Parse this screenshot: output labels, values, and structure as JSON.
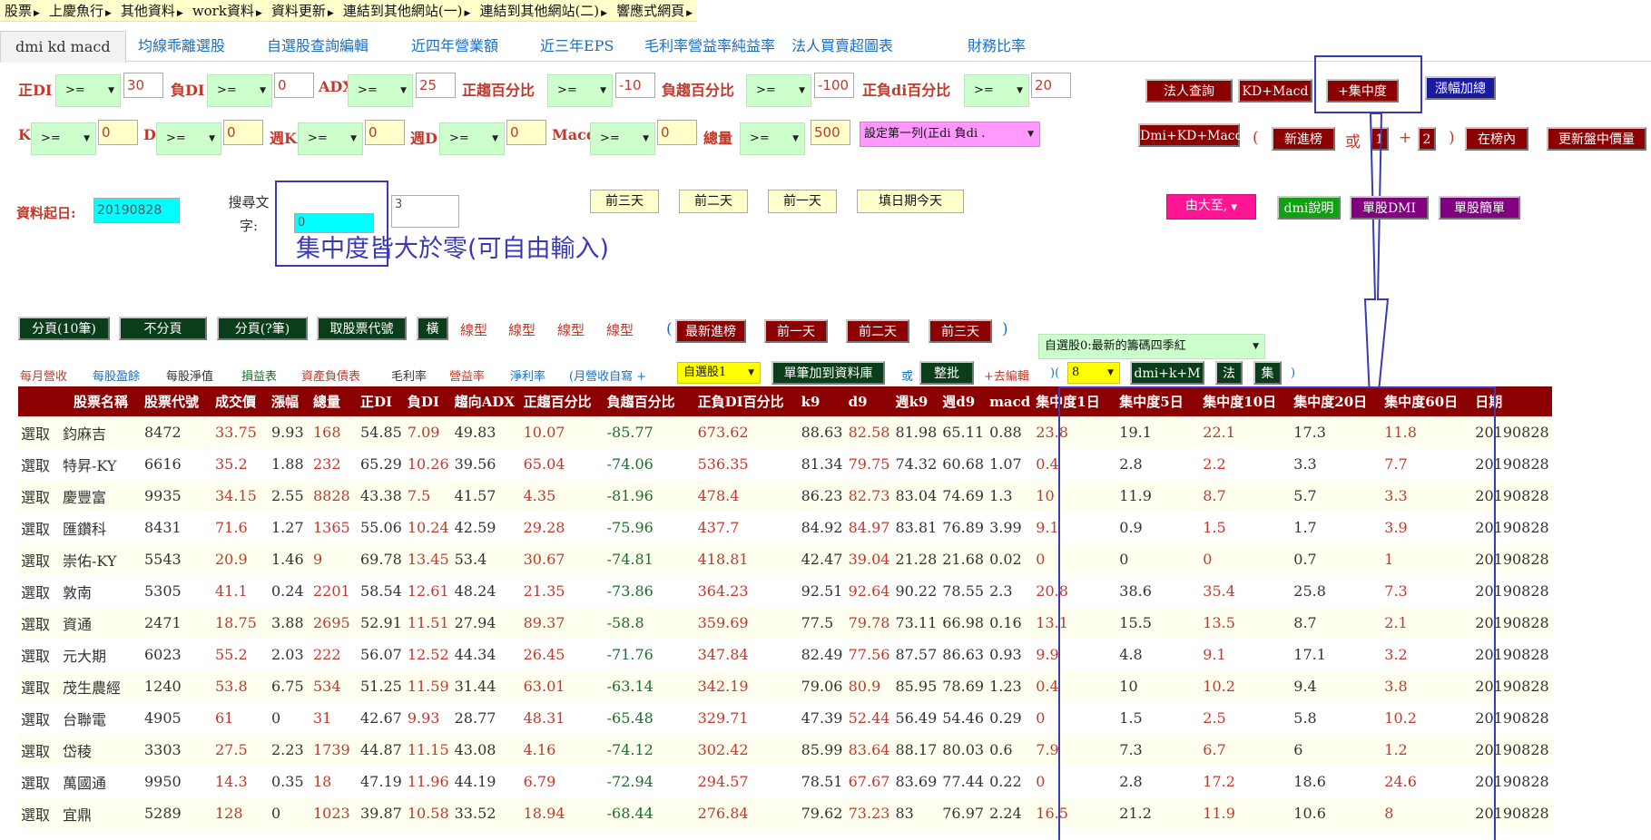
{
  "topnav": [
    "股票",
    "上慶魚行",
    "其他資料",
    "work資料",
    "資料更新",
    "連結到其他網站(一)",
    "連結到其他網站(二)",
    "響應式網頁"
  ],
  "tabs": [
    "dmi kd macd",
    "均線乖離選股",
    "自選股查詢編輯",
    "近四年營業額",
    "近三年EPS",
    "毛利率營益率純益率",
    "法人買賣超圖表",
    "財務比率"
  ],
  "row1": {
    "labels": [
      "正DI",
      "負DI",
      "ADX",
      "正趨百分比",
      "負趨百分比",
      "正負di百分比"
    ],
    "ops": [
      ">=",
      ">=",
      ">=",
      ">=",
      ">=",
      ">="
    ],
    "values": [
      "30",
      "0",
      "25",
      "-10",
      "-100",
      "20"
    ]
  },
  "row2": {
    "labels": [
      "K",
      "D",
      "週K",
      "週D",
      "Macd",
      "總量"
    ],
    "ops": [
      ">=",
      ">=",
      ">=",
      ">=",
      ">=",
      ">="
    ],
    "values": [
      "0",
      "0",
      "0",
      "0",
      "0",
      "500"
    ],
    "sort_select": "設定第一列(正di 負di ."
  },
  "buttons": {
    "inst": "法人查詢",
    "kdmacd": "KD+Macd",
    "conc": "+集中度",
    "rise": "漲幅加總",
    "dmikdmacd": "Dmi+KD+Macd",
    "paren_open": "(",
    "newlist": "新進榜",
    "or": "或",
    "n1": "1",
    "plus": "+",
    "n2": "2",
    "paren_close": ")",
    "inlist": "在榜內",
    "update": "更新盤中價量"
  },
  "date": {
    "label": "資料起日:",
    "value": "20190828"
  },
  "search": {
    "label": "搜尋文字:",
    "value": "0",
    "textarea": "3"
  },
  "daybtns": [
    "前三天",
    "前二天",
    "前一天",
    "填日期今天"
  ],
  "rightbtns": {
    "sort": "由大至,",
    "dmi_help": "dmi說明",
    "single_dmi": "單股DMI",
    "single_simple": "單股簡單"
  },
  "annotation": "集中度皆大於零(可自由輸入)",
  "row4": {
    "btns": [
      "分頁(10筆)",
      "不分頁",
      "分頁(?筆)",
      "取股票代號",
      "橫"
    ],
    "lines": [
      "線型",
      "線型",
      "線型",
      "線型"
    ],
    "paren_open": "(",
    "hist": [
      "最新進榜",
      "前一天",
      "前二天",
      "前三天"
    ],
    "paren_close": ")"
  },
  "fav_select": "自選股0:最新的籌碼四季紅",
  "row5": {
    "links": [
      "每月營收",
      "每股盈餘",
      "每股淨值",
      "損益表",
      "資產負債表",
      "毛利率",
      "營益率",
      "淨利率"
    ],
    "monthly": "(月營收自寫 +",
    "fav1": "自選股1",
    "addlib": "單筆加到資料庫",
    "or": "或",
    "batch": "整批",
    "edit": "+去編輯",
    "paren": ")(",
    "num": "8",
    "dmikm": "dmi+k+M",
    "fa": "法",
    "ji": "集",
    "close": ")"
  },
  "table": {
    "headers": [
      "",
      "股票名稱",
      "股票代號",
      "成交價",
      "漲幅",
      "總量",
      "正DI",
      "負DI",
      "趨向ADX",
      "正趨百分比",
      "負趨百分比",
      "正負DI百分比",
      "k9",
      "d9",
      "週k9",
      "週d9",
      "macd",
      "集中度1日",
      "集中度5日",
      "集中度10日",
      "集中度20日",
      "集中度60日",
      "日期"
    ],
    "rows": [
      [
        "選取",
        "鈞麻吉",
        "8472",
        "33.75",
        "9.93",
        "168",
        "54.85",
        "7.09",
        "49.83",
        "10.07",
        "-85.77",
        "673.62",
        "88.63",
        "82.58",
        "81.98",
        "65.11",
        "0.88",
        "23.8",
        "19.1",
        "22.1",
        "17.3",
        "11.8",
        "20190828"
      ],
      [
        "選取",
        "特昇-KY",
        "6616",
        "35.2",
        "1.88",
        "232",
        "65.29",
        "10.26",
        "39.56",
        "65.04",
        "-74.06",
        "536.35",
        "81.34",
        "79.75",
        "74.32",
        "60.68",
        "1.07",
        "0.4",
        "2.8",
        "2.2",
        "3.3",
        "7.7",
        "20190828"
      ],
      [
        "選取",
        "慶豐富",
        "9935",
        "34.15",
        "2.55",
        "8828",
        "43.38",
        "7.5",
        "41.57",
        "4.35",
        "-81.96",
        "478.4",
        "86.23",
        "82.73",
        "83.04",
        "74.69",
        "1.3",
        "10",
        "11.9",
        "8.7",
        "5.7",
        "3.3",
        "20190828"
      ],
      [
        "選取",
        "匯鑽科",
        "8431",
        "71.6",
        "1.27",
        "1365",
        "55.06",
        "10.24",
        "42.59",
        "29.28",
        "-75.96",
        "437.7",
        "84.92",
        "84.97",
        "83.81",
        "76.89",
        "3.99",
        "9.1",
        "0.9",
        "1.5",
        "1.7",
        "3.9",
        "20190828"
      ],
      [
        "選取",
        "崇佑-KY",
        "5543",
        "20.9",
        "1.46",
        "9",
        "69.78",
        "13.45",
        "53.4",
        "30.67",
        "-74.81",
        "418.81",
        "42.47",
        "39.04",
        "21.28",
        "21.68",
        "0.02",
        "0",
        "0",
        "0",
        "0.7",
        "1",
        "20190828"
      ],
      [
        "選取",
        "敦南",
        "5305",
        "41.1",
        "0.24",
        "2201",
        "58.54",
        "12.61",
        "48.24",
        "21.35",
        "-73.86",
        "364.23",
        "92.51",
        "92.64",
        "90.22",
        "78.55",
        "2.3",
        "20.8",
        "38.6",
        "35.4",
        "25.8",
        "7.3",
        "20190828"
      ],
      [
        "選取",
        "資通",
        "2471",
        "18.75",
        "3.88",
        "2695",
        "52.91",
        "11.51",
        "27.94",
        "89.37",
        "-58.8",
        "359.69",
        "77.5",
        "79.78",
        "73.11",
        "66.98",
        "0.16",
        "13.1",
        "15.5",
        "13.5",
        "8.7",
        "2.1",
        "20190828"
      ],
      [
        "選取",
        "元大期",
        "6023",
        "55.2",
        "2.03",
        "222",
        "56.07",
        "12.52",
        "44.34",
        "26.45",
        "-71.76",
        "347.84",
        "82.49",
        "77.56",
        "87.57",
        "86.63",
        "0.93",
        "9.9",
        "4.8",
        "9.1",
        "17.1",
        "3.2",
        "20190828"
      ],
      [
        "選取",
        "茂生農經",
        "1240",
        "53.8",
        "6.75",
        "534",
        "51.25",
        "11.59",
        "31.44",
        "63.01",
        "-63.14",
        "342.19",
        "79.06",
        "80.9",
        "85.95",
        "78.69",
        "1.23",
        "0.4",
        "10",
        "10.2",
        "9.4",
        "3.8",
        "20190828"
      ],
      [
        "選取",
        "台聯電",
        "4905",
        "61",
        "0",
        "31",
        "42.67",
        "9.93",
        "28.77",
        "48.31",
        "-65.48",
        "329.71",
        "47.39",
        "52.44",
        "56.49",
        "54.46",
        "0.29",
        "0",
        "1.5",
        "2.5",
        "5.8",
        "10.2",
        "20190828"
      ],
      [
        "選取",
        "岱稜",
        "3303",
        "27.5",
        "2.23",
        "1739",
        "44.87",
        "11.15",
        "43.08",
        "4.16",
        "-74.12",
        "302.42",
        "85.99",
        "83.64",
        "88.17",
        "80.03",
        "0.6",
        "7.9",
        "7.3",
        "6.7",
        "6",
        "1.2",
        "20190828"
      ],
      [
        "選取",
        "萬國通",
        "9950",
        "14.3",
        "0.35",
        "18",
        "47.19",
        "11.96",
        "44.19",
        "6.79",
        "-72.94",
        "294.57",
        "78.51",
        "67.67",
        "83.69",
        "77.44",
        "0.22",
        "0",
        "2.8",
        "17.2",
        "18.6",
        "24.6",
        "20190828"
      ],
      [
        "選取",
        "宜鼎",
        "5289",
        "128",
        "0",
        "1023",
        "39.87",
        "10.58",
        "33.52",
        "18.94",
        "-68.44",
        "276.84",
        "79.62",
        "73.23",
        "83",
        "76.97",
        "2.24",
        "16.5",
        "21.2",
        "11.9",
        "10.6",
        "8",
        "20190828"
      ]
    ]
  }
}
